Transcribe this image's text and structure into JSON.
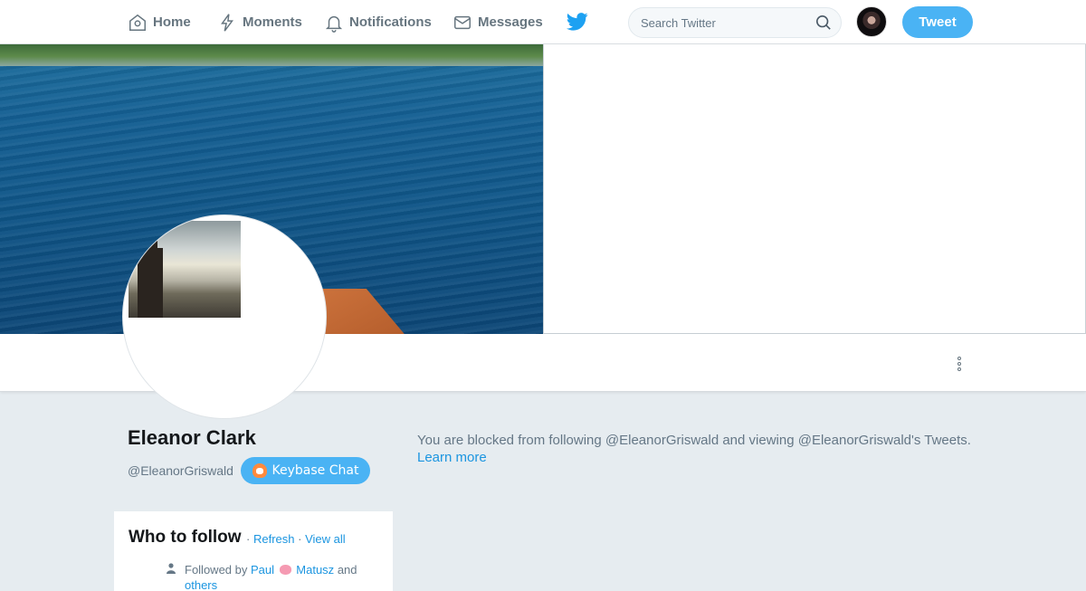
{
  "nav": {
    "home_label": "Home",
    "moments_label": "Moments",
    "notifications_label": "Notifications",
    "messages_label": "Messages",
    "logo_icon": "twitter-bird-icon",
    "search_placeholder": "Search Twitter",
    "tweet_label": "Tweet"
  },
  "colors": {
    "accent": "#4ab3f4",
    "link": "#1b95e0",
    "background": "#e6ecf0",
    "muted_text": "#657786"
  },
  "profile": {
    "name": "Eleanor Clark",
    "handle": "@EleanorGriswald",
    "keybase_label": "Keybase Chat"
  },
  "blocked": {
    "message": "You are blocked from following @EleanorGriswald and viewing @EleanorGriswald's Tweets.",
    "learn_more": "Learn more"
  },
  "who_to_follow": {
    "title": "Who to follow",
    "separator": "·",
    "refresh_label": "Refresh",
    "view_all_label": "View all",
    "followed_by_prefix": "Followed by",
    "follower_first": "Paul",
    "follower_last": "Matusz",
    "and_word": "and",
    "others_label": "others"
  }
}
